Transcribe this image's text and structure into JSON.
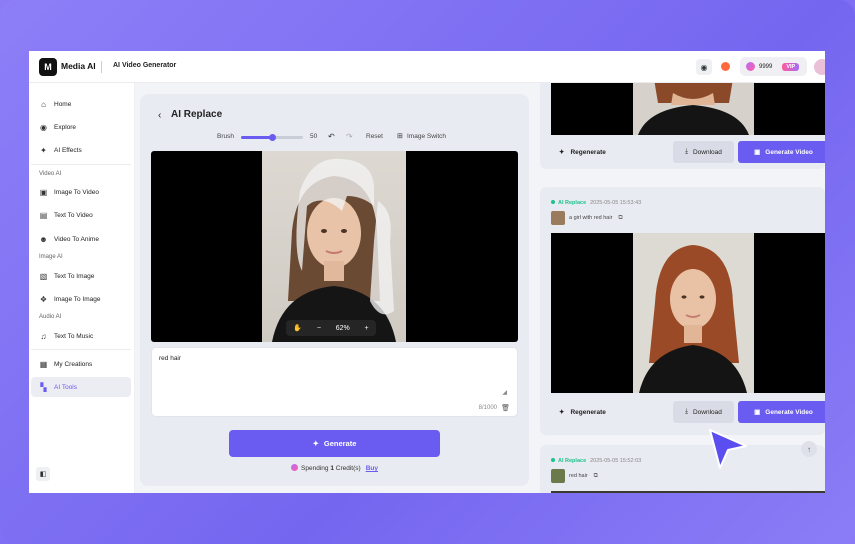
{
  "app": {
    "brand": "Media AI",
    "logo_text": "M",
    "tool_title": "AI Video Generator",
    "credits": "9999",
    "vip_label": "VIP"
  },
  "sidebar": {
    "items_top": [
      {
        "label": "Home",
        "icon": "home-icon"
      },
      {
        "label": "Explore",
        "icon": "compass-icon"
      },
      {
        "label": "AI Effects",
        "icon": "sparkle-icon"
      }
    ],
    "sections": [
      {
        "title": "Video AI",
        "items": [
          {
            "label": "Image To Video",
            "icon": "video-camera-icon"
          },
          {
            "label": "Text To Video",
            "icon": "video-text-icon"
          },
          {
            "label": "Video To Anime",
            "icon": "anime-icon"
          }
        ]
      },
      {
        "title": "Image AI",
        "items": [
          {
            "label": "Text To Image",
            "icon": "image-icon"
          },
          {
            "label": "Image To Image",
            "icon": "image-swap-icon"
          }
        ]
      },
      {
        "title": "Audio AI",
        "items": [
          {
            "label": "Text To Music",
            "icon": "music-icon"
          }
        ]
      }
    ],
    "items_bottom": [
      {
        "label": "My Creations",
        "icon": "folder-icon"
      },
      {
        "label": "AI Tools",
        "icon": "grid-icon",
        "active": true
      }
    ]
  },
  "editor": {
    "title": "AI Replace",
    "brush_label": "Brush",
    "brush_value": "50",
    "brush_level": 0.5,
    "reset_label": "Reset",
    "image_switch_label": "Image Switch",
    "zoom_value": "62%",
    "zoom_minus": "−",
    "zoom_plus": "+",
    "prompt_value": "red hair",
    "char_count": "8/1000",
    "generate_label": "Generate",
    "spending_prefix": "Spending",
    "spending_amount": "1",
    "spending_suffix": "Credit(s)",
    "buy_label": "Buy"
  },
  "results": [
    {
      "regenerate_label": "Regenerate",
      "download_label": "Download",
      "generate_video_label": "Generate Video"
    },
    {
      "tag": "AI Replace",
      "timestamp": "2025-05-05 15:53:43",
      "prompt": "a girl with red hair",
      "regenerate_label": "Regenerate",
      "download_label": "Download",
      "generate_video_label": "Generate Video"
    },
    {
      "tag": "AI Replace",
      "timestamp": "2025-05-05 15:52:03",
      "prompt": "red hair"
    }
  ],
  "colors": {
    "accent": "#6a5cf0",
    "success": "#1ec28b",
    "background": "#8b7cf6"
  }
}
